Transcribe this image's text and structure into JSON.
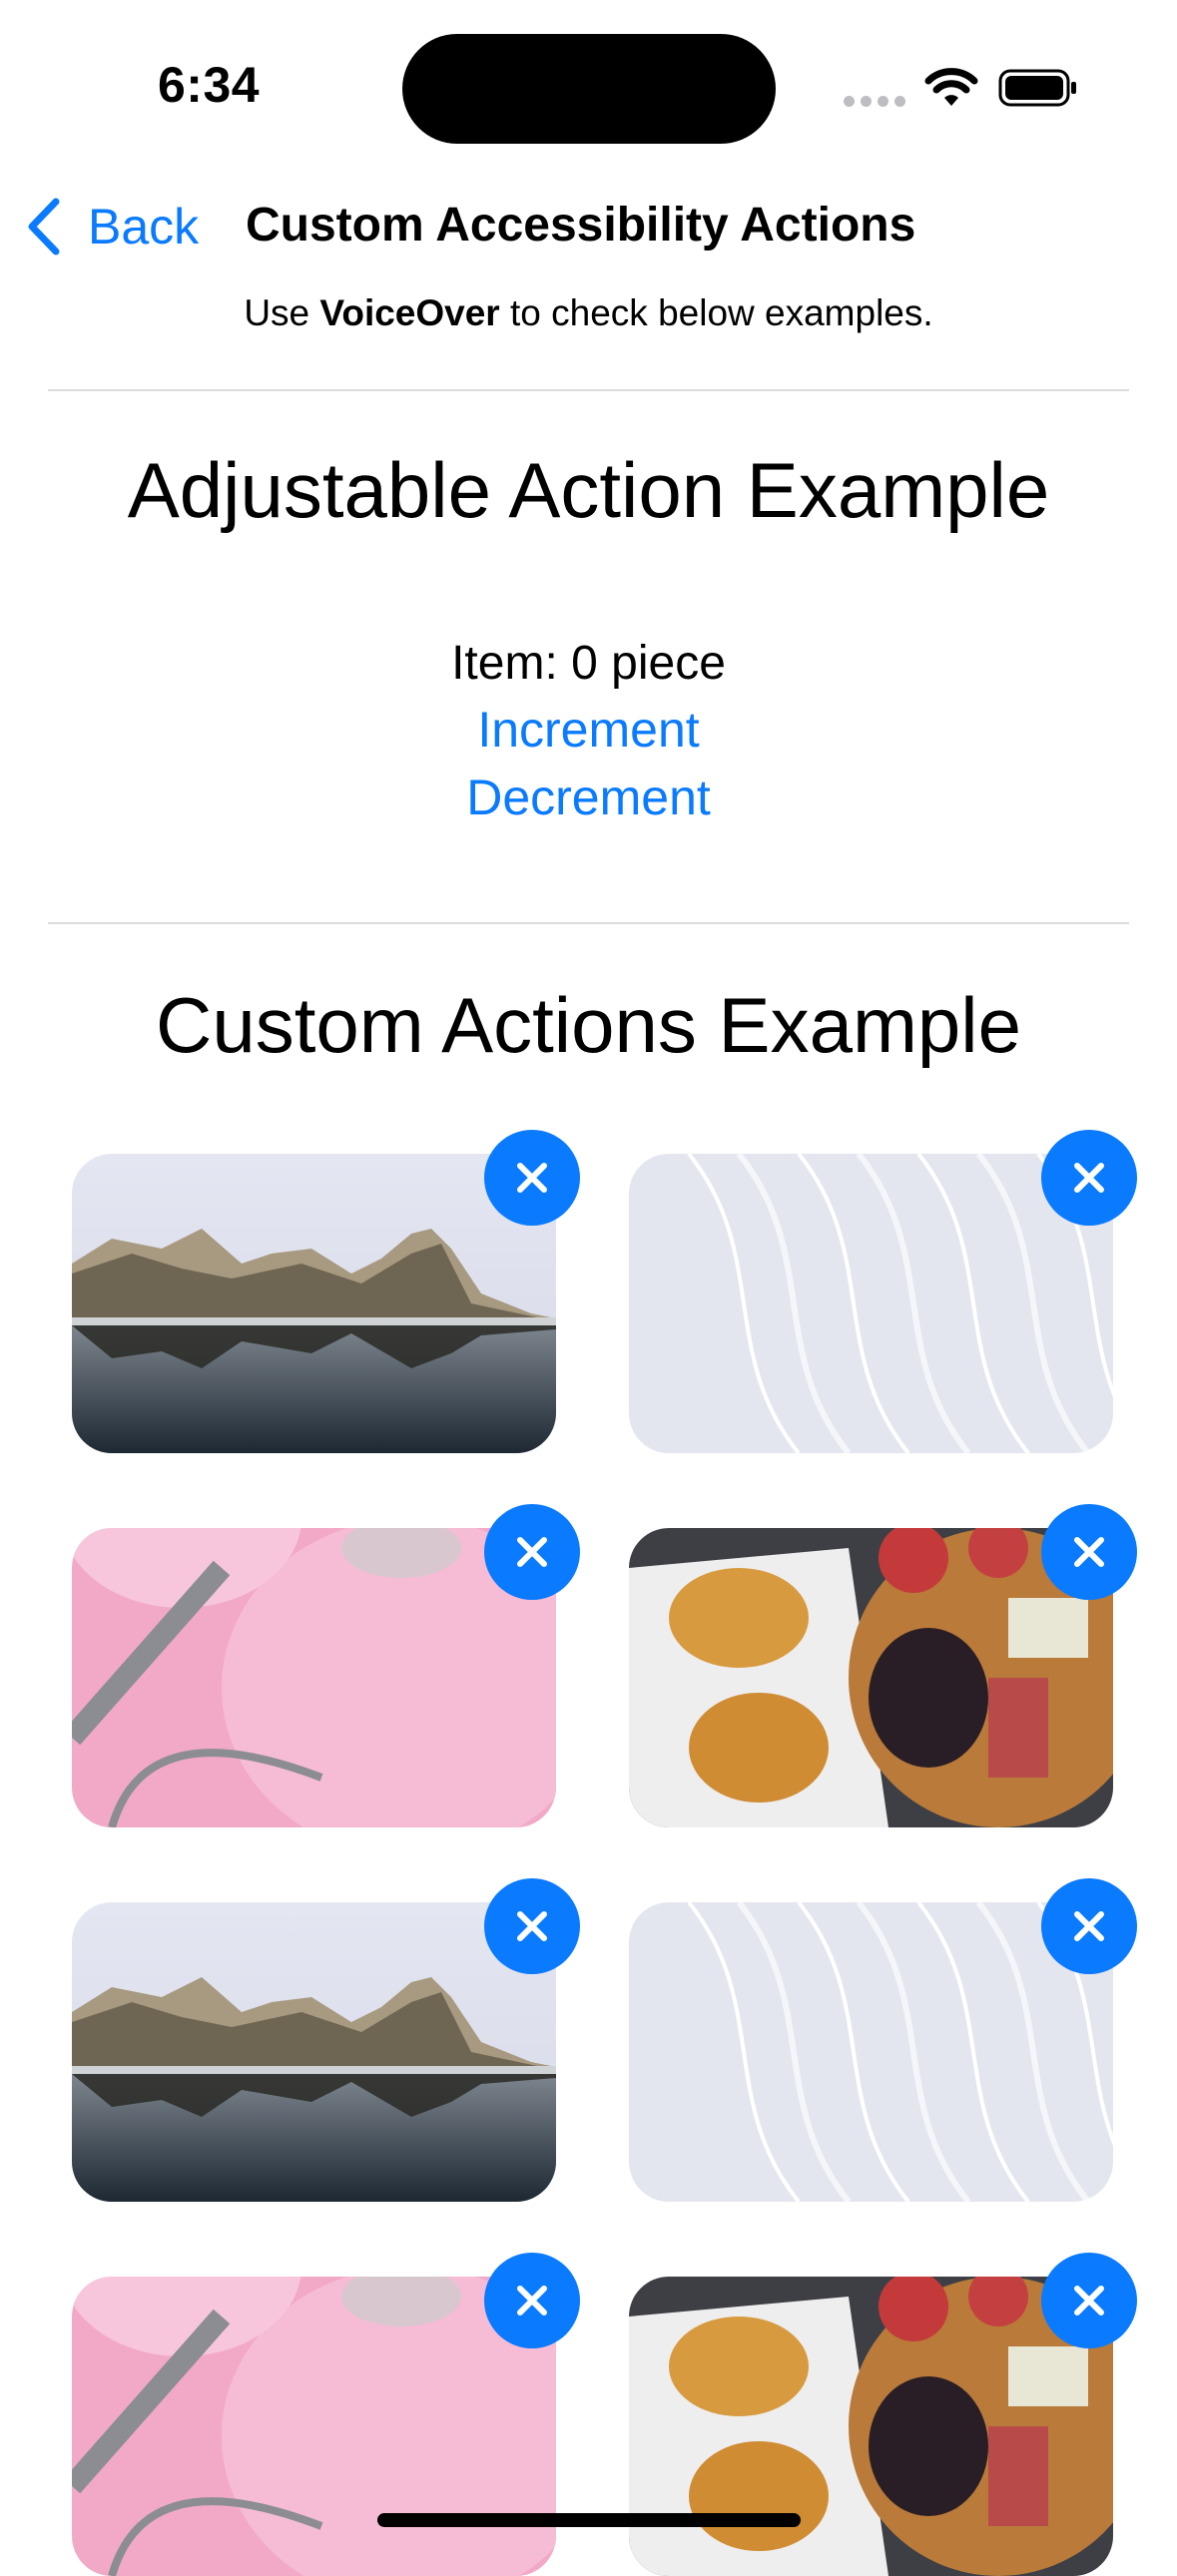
{
  "status_bar": {
    "time": "6:34"
  },
  "nav": {
    "back_label": "Back",
    "title": "Custom Accessibility Actions"
  },
  "subtitle": {
    "prefix": "Use ",
    "bold": "VoiceOver",
    "suffix": " to check below examples."
  },
  "adjustable": {
    "title": "Adjustable Action Example",
    "item_label": "Item: 0 piece",
    "increment_label": "Increment",
    "decrement_label": "Decrement"
  },
  "custom": {
    "title": "Custom Actions Example",
    "images": [
      {
        "kind": "mountain-lake"
      },
      {
        "kind": "white-waves"
      },
      {
        "kind": "pink-abstract"
      },
      {
        "kind": "food-platter"
      },
      {
        "kind": "mountain-lake"
      },
      {
        "kind": "white-waves"
      },
      {
        "kind": "pink-abstract"
      },
      {
        "kind": "food-platter"
      }
    ]
  },
  "colors": {
    "accent": "#0a7aff"
  }
}
